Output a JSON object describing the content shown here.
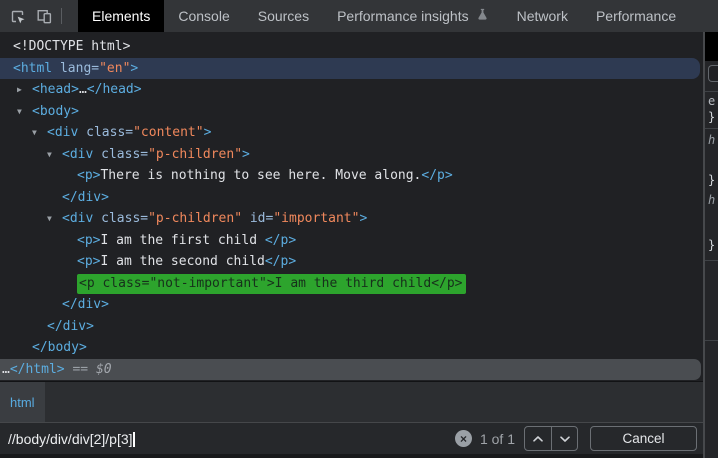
{
  "toolbar": {
    "tabs": [
      {
        "label": "Elements",
        "selected": true
      },
      {
        "label": "Console",
        "selected": false
      },
      {
        "label": "Sources",
        "selected": false
      },
      {
        "label": "Performance insights",
        "selected": false,
        "icon": "flask"
      },
      {
        "label": "Network",
        "selected": false
      },
      {
        "label": "Performance",
        "selected": false
      }
    ]
  },
  "tree": {
    "rows": {
      "doctype": {
        "text": "<!DOCTYPE html>"
      },
      "html_open": {
        "tag_open": "<html ",
        "attr": "lang=",
        "value": "\"en\"",
        "tag_end": ">"
      },
      "head": {
        "arrow": "▶",
        "tag_open": "<head>",
        "ellipsis": "…",
        "tag_close": "</head>"
      },
      "body_open": {
        "arrow": "▼",
        "tag": "<body>"
      },
      "div_content": {
        "arrow": "▼",
        "tag_open": "<div ",
        "attr": "class=",
        "value": "\"content\"",
        "tag_end": ">"
      },
      "div_pchildren": {
        "arrow": "▼",
        "tag_open": "<div ",
        "attr": "class=",
        "value": "\"p-children\"",
        "tag_end": ">"
      },
      "p_nothing": {
        "tag_open": "<p>",
        "text": "There is nothing to see here. Move along.",
        "tag_close": "</p>"
      },
      "div_close_1": {
        "tag": "</div>"
      },
      "div_important": {
        "arrow": "▼",
        "tag_open": "<div ",
        "attr1": "class=",
        "value1": "\"p-children\"",
        "attr2": " id=",
        "value2": "\"important\"",
        "tag_end": ">"
      },
      "p_first": {
        "tag_open": "<p>",
        "text": "I am the first child ",
        "tag_close": "</p>"
      },
      "p_second": {
        "tag_open": "<p>",
        "text": "I am the second child",
        "tag_close": "</p>"
      },
      "p_third_match": {
        "text": "<p class=\"not-important\">I am the third child</p>"
      },
      "div_close_2": {
        "tag": "</div>"
      },
      "div_close_3": {
        "tag": "</div>"
      },
      "body_close": {
        "tag": "</body>"
      },
      "html_close": {
        "dots": "…",
        "tag": "</html>",
        "eq": " == ",
        "dollar": "$0"
      }
    }
  },
  "breadcrumb": {
    "items": [
      {
        "label": "html"
      }
    ]
  },
  "findbar": {
    "query": "//body/div/div[2]/p[3]",
    "match_count": "1 of 1",
    "clear_icon": "×",
    "cancel_label": "Cancel"
  },
  "styles_sidebar": {
    "fragments": [
      "e",
      "}",
      "h",
      "}",
      "h",
      "}"
    ]
  },
  "colors": {
    "match_highlight_bg": "#2da42d",
    "selected_open_tag_bg": "#2e3a52",
    "selected_close_tag_bg": "#4a4d51",
    "tag_blue": "#5cade0",
    "attribute_name_blue": "#9bbbdc",
    "attribute_value_orange": "#f0885c",
    "selected_tab_bg": "#000000"
  }
}
